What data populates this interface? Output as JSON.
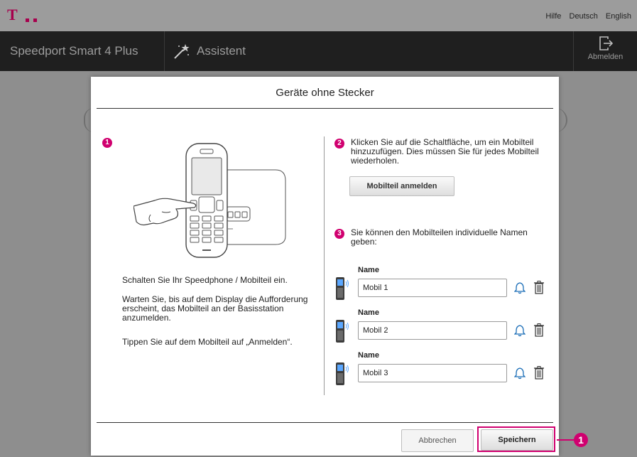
{
  "topbar": {
    "logo": "T",
    "links": [
      "Hilfe",
      "Deutsch",
      "English"
    ]
  },
  "navbar": {
    "product": "Speedport Smart 4 Plus",
    "assistant": "Assistent",
    "logout": "Abmelden"
  },
  "dialog": {
    "title": "Geräte ohne Stecker",
    "step1": {
      "badge": "1",
      "text_power": "Schalten Sie Ihr Speedphone / Mobilteil ein.",
      "text_wait": "Warten Sie, bis auf dem Display die Aufforderung erscheint, das Mobilteil an der Basisstation anzumelden.",
      "text_tap": "Tippen Sie auf dem Mobilteil auf „Anmelden“."
    },
    "step2": {
      "badge": "2",
      "text": "Klicken Sie auf die Schaltfläche, um ein Mobilteil hinzuzufügen. Dies müssen Sie für jedes Mobilteil wiederholen.",
      "button": "Mobilteil anmelden"
    },
    "step3": {
      "badge": "3",
      "text": "Sie können den Mobilteilen individuelle Namen geben:",
      "handsets": [
        {
          "label": "Name",
          "value": "Mobil 1"
        },
        {
          "label": "Name",
          "value": "Mobil 2"
        },
        {
          "label": "Name",
          "value": "Mobil 3"
        }
      ]
    },
    "buttons": {
      "cancel": "Abbrechen",
      "save": "Speichern"
    },
    "callout": "1"
  },
  "colors": {
    "magenta": "#d0006f",
    "navbar": "#1f1f1f",
    "overlay": "#8e8e8e"
  },
  "icons": [
    "wand-icon",
    "logout-icon",
    "handset-icon",
    "bell-icon",
    "trash-icon"
  ]
}
